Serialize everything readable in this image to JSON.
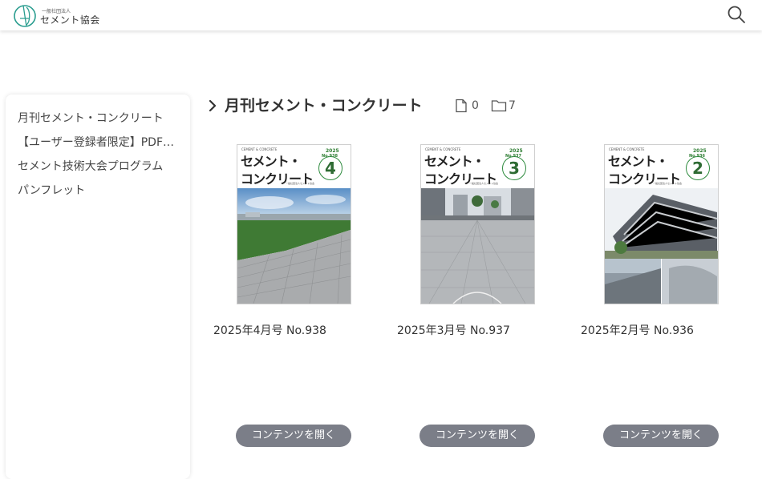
{
  "header": {
    "logo_small": "一般社団法人",
    "logo_name": "セメント協会",
    "search_icon": "search-icon"
  },
  "sidebar": {
    "items": [
      {
        "label": "月刊セメント・コンクリート"
      },
      {
        "label": "【ユーザー登録者限定】PDF版バックナンバー"
      },
      {
        "label": "セメント技術大会プログラム"
      },
      {
        "label": "パンフレット"
      }
    ]
  },
  "main": {
    "title": "月刊セメント・コンクリート",
    "file_count": "0",
    "folder_count": "7",
    "button_label": "コンテンツを開く",
    "cards": [
      {
        "caption": "2025年4月号 No.938",
        "cover": {
          "en": "CEMENT & CONCRETE",
          "t1": "セメント・",
          "t2": "コンクリート",
          "year": "2025",
          "no": "No.938",
          "issue": "4",
          "pub": "一般社団法人セメント協会"
        }
      },
      {
        "caption": "2025年3月号 No.937",
        "cover": {
          "en": "CEMENT & CONCRETE",
          "t1": "セメント・",
          "t2": "コンクリート",
          "year": "2025",
          "no": "No.937",
          "issue": "3",
          "pub": "一般社団法人セメント協会"
        }
      },
      {
        "caption": "2025年2月号 No.936",
        "cover": {
          "en": "CEMENT & CONCRETE",
          "t1": "セメント・",
          "t2": "コンクリート",
          "year": "2025",
          "no": "No.936",
          "issue": "2",
          "pub": "一般社団法人セメント協会"
        }
      }
    ]
  },
  "colors": {
    "accent_green": "#2e8b3e",
    "button_gray": "#7b7e88",
    "logo_teal": "#2a9d8f"
  }
}
